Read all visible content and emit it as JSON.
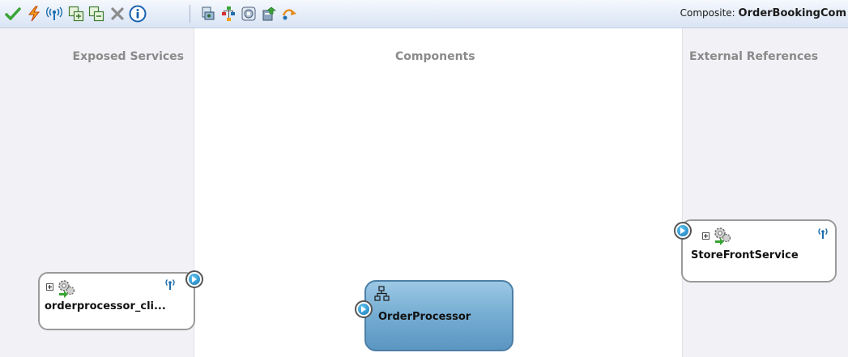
{
  "toolbar": {
    "icons": [
      "validate-checkmark-icon",
      "lightning-icon",
      "wireless-service-icon",
      "expand-all-icon",
      "collapse-all-icon",
      "delete-icon",
      "info-icon",
      "component-icon",
      "hierarchy-icon",
      "database-icon",
      "deploy-icon",
      "route-arrow-icon"
    ],
    "composite_label": "Composite:",
    "composite_name": "OrderBookingCom"
  },
  "lanes": {
    "exposed_services": "Exposed Services",
    "components": "Components",
    "external_references": "External References"
  },
  "exposed_service": {
    "name": "orderprocessor_cli..."
  },
  "component": {
    "name": "OrderProcessor"
  },
  "external_reference": {
    "name": "StoreFrontService"
  },
  "colors": {
    "toolbar_bg": "#e4ecf8",
    "lane_bg": "#f2f2f6",
    "component_fill": "#74acd2",
    "component_border": "#4d7fa6",
    "port_blue": "#1476b8"
  }
}
